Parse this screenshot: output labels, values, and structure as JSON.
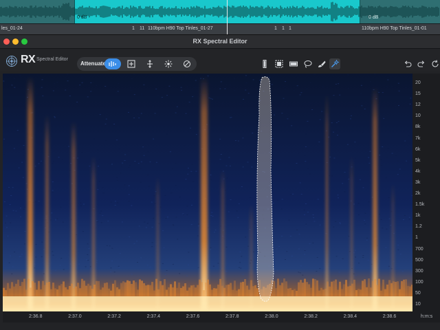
{
  "daw": {
    "clip_names": [
      "les_01-24",
      "1",
      "11",
      "110bpm H90 Top Tinles_01-27",
      "1",
      "1",
      "1",
      "110bpm H90 Top Tinles_01-01"
    ],
    "gain_labels": [
      "0 dB",
      "0 dB"
    ]
  },
  "window": {
    "title": "RX Spectral Editor"
  },
  "toolbar": {
    "logo_text": "RX",
    "logo_subtitle": "Spectral Editor",
    "mode_label": "Attenuate",
    "mode_buttons": [
      "attenuate-mode-icon",
      "gain-mode-icon",
      "replace-mode-icon",
      "pattern-mode-icon",
      "disable-mode-icon"
    ],
    "selection_tools": [
      "time-selection-icon",
      "rectangle-selection-icon",
      "frequency-selection-icon",
      "lasso-icon",
      "brush-icon",
      "magic-wand-icon"
    ],
    "history": [
      "undo-icon",
      "redo-icon",
      "loop-icon"
    ],
    "accent_color": "#3a8de8"
  },
  "spectrogram": {
    "freq_labels": [
      "20",
      "15",
      "12",
      "10",
      "8k",
      "7k",
      "6k",
      "5k",
      "4k",
      "3k",
      "2k",
      "1.5k",
      "1k",
      "1.2",
      "1",
      "700",
      "500",
      "300",
      "100",
      "50",
      "10"
    ],
    "time_labels": [
      "2:36.8",
      "2:37.0",
      "2:37.2",
      "2:37.4",
      "2:37.6",
      "2:37.8",
      "2:38.0",
      "2:38.2",
      "2:38.4",
      "2:38.6"
    ],
    "time_unit": "h:m:s",
    "palette": [
      "#0a1530",
      "#1a2f6a",
      "#d97a2a",
      "#ffe9b0"
    ]
  }
}
